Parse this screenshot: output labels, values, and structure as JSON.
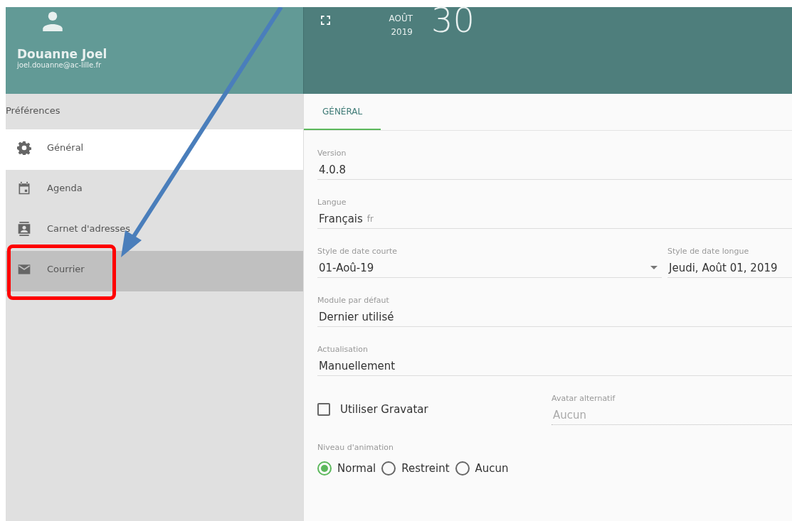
{
  "user": {
    "name": "Douanne Joel",
    "email": "joel.douanne@ac-lille.fr"
  },
  "header": {
    "month": "AOÛT",
    "year": "2019",
    "day": "30"
  },
  "sidebar": {
    "title": "Préférences",
    "items": [
      {
        "label": "Général",
        "selected": true,
        "hovered": false
      },
      {
        "label": "Agenda",
        "selected": false,
        "hovered": false
      },
      {
        "label": "Carnet d'adresses",
        "selected": false,
        "hovered": false
      },
      {
        "label": "Courrier",
        "selected": false,
        "hovered": true
      }
    ]
  },
  "tabs": [
    {
      "label": "GÉNÉRAL",
      "selected": true
    }
  ],
  "fields": [
    {
      "kind": "text",
      "label": "Version",
      "value": "4.0.8"
    },
    {
      "kind": "text",
      "label": "Langue",
      "value": "Français",
      "hint": "fr"
    },
    {
      "kind": "pair",
      "label": "Style de date courte",
      "value": "01-Aoû-19",
      "label_2": "Style de date longue",
      "value_2": "Jeudi, Août 01, 2019"
    },
    {
      "kind": "text",
      "label": "Module par défaut",
      "value": "Dernier utilisé"
    },
    {
      "kind": "text",
      "label": "Actualisation",
      "value": "Manuellement"
    },
    {
      "kind": "checkbox",
      "label": "Utiliser Gravatar",
      "checked": false,
      "label_2": "Avatar alternatif",
      "placeholder": "Aucun",
      "disabled": true
    },
    {
      "kind": "radio",
      "label": "Niveau d'animation",
      "options": [
        {
          "label": "Normal",
          "selected": true
        },
        {
          "label": "Restreint",
          "selected": false
        },
        {
          "label": "Aucun",
          "selected": false
        }
      ]
    }
  ]
}
